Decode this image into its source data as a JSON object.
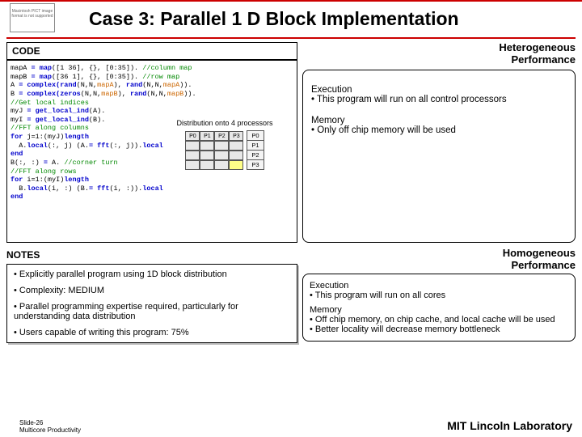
{
  "pict_notice": "Macintosh PICT\nimage format\nis not supported",
  "title": "Case 3: Parallel 1 D Block Implementation",
  "code": {
    "header": "CODE",
    "lines": [
      {
        "pre": "mapA ",
        "kw": "= map",
        "post": "([1 36], {}, [0:35]).",
        "cm": " //column map"
      },
      {
        "pre": "mapB ",
        "kw": "= map",
        "post": "([36 1], {}, [0:35]).",
        "cm": " //row map"
      },
      {
        "pre": "A ",
        "kw": "= complex(rand",
        "post": "(N,N,",
        "op": "mapA",
        "post2": "), ",
        "kw2": "rand",
        "post3": "(N,N,",
        "op2": "mapA",
        "post4": "))."
      },
      {
        "pre": "B ",
        "kw": "= complex(zeros",
        "post": "(N,N,",
        "op": "mapB",
        "post2": "), ",
        "kw2": "rand",
        "post3": "(N,N,",
        "op2": "mapB",
        "post4": "))."
      },
      {
        "cm": "//Get local indices"
      },
      {
        "pre": "myJ ",
        "kw": "= get_local_ind",
        "post": "(A)."
      },
      {
        "pre": "myI ",
        "kw": "= get_local_ind",
        "post": "(B)."
      },
      {
        "cm": "//FFT along columns"
      },
      {
        "kw": "for",
        "post": " j=1:",
        "kw2": "length",
        "post2": "(myJ)"
      },
      {
        "pre": "  A.",
        "kw": "local",
        "post": "(:, j) ",
        "kw2": "= fft",
        "post2": "(A.",
        "kw3": "local",
        "post3": "(:, j))."
      },
      {
        "kw": "end"
      },
      {
        "pre": "B(:, :) ",
        "kw": "=",
        "post": " A.",
        "cm": " //corner turn"
      },
      {
        "cm": "//FFT along rows"
      },
      {
        "kw": "for",
        "post": " i=1:",
        "kw2": "length",
        "post2": "(myI)"
      },
      {
        "pre": "  B.",
        "kw": "local",
        "post": "(i, :) ",
        "kw2": "= fft",
        "post2": "(B.",
        "kw3": "local",
        "post3": "(i, :))."
      },
      {
        "kw": "end"
      }
    ],
    "dist_caption": "Distribution onto 4 processors",
    "grid_labels": [
      "P0",
      "P1",
      "P2",
      "P3"
    ],
    "proc_rows": [
      "P0",
      "P1",
      "P2",
      "P3"
    ]
  },
  "hetero": {
    "header": "Heterogeneous\nPerformance",
    "exec_h": "Execution",
    "exec_b": "• This program will run on all control processors",
    "mem_h": "Memory",
    "mem_b": "• Only off chip memory will be used"
  },
  "notes": {
    "header": "NOTES",
    "items": [
      "Explicitly parallel program using 1D block distribution",
      "Complexity: MEDIUM",
      "Parallel programming expertise required, particularly for understanding data distribution",
      "Users capable of writing this program: 75%"
    ]
  },
  "homo": {
    "header": "Homogeneous\nPerformance",
    "exec_h": "Execution",
    "exec_b": "• This program will run on all cores",
    "mem_h": "Memory",
    "mem_b1": "• Off chip memory, on chip cache, and local cache will be used",
    "mem_b2": "• Better locality will decrease memory bottleneck"
  },
  "footer": {
    "slide": "Slide-26",
    "sub": "Multicore Productivity",
    "lab": "MIT Lincoln Laboratory"
  }
}
